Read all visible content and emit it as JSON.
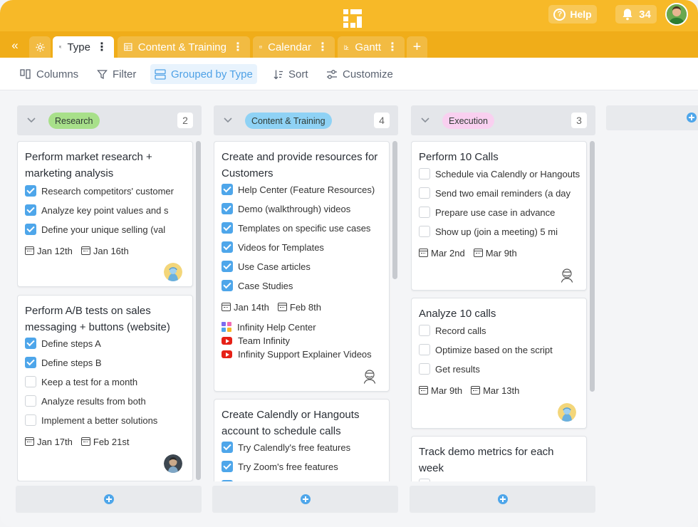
{
  "header": {
    "help_label": "Help",
    "notifications_count": "34"
  },
  "tabs": [
    {
      "label": "Type",
      "menu": "⋮"
    },
    {
      "label": "Content & Training",
      "menu": "⋮"
    },
    {
      "label": "Calendar",
      "menu": "⋮"
    },
    {
      "label": "Gantt",
      "menu": "⋮"
    }
  ],
  "toolbar": {
    "columns_label": "Columns",
    "filter_label": "Filter",
    "grouped_label": "Grouped by Type",
    "sort_label": "Sort",
    "customize_label": "Customize"
  },
  "colors": {
    "topbar": "#f7b928",
    "accent": "#4ea6ea",
    "research": "#a8e08a",
    "content": "#8fd2f5",
    "execution": "#f9d0f0"
  },
  "columns": [
    {
      "label": "Research",
      "count": "2",
      "cards": [
        {
          "title": "Perform market research + marketing analysis",
          "checklist": [
            {
              "text": "Research competitors' customer",
              "checked": true
            },
            {
              "text": "Analyze key point values and s",
              "checked": true
            },
            {
              "text": "Define your unique selling (val",
              "checked": true
            }
          ],
          "dates": [
            "Jan 12th",
            "Jan 16th"
          ]
        },
        {
          "title": "Perform A/B tests on sales messaging + buttons (website)",
          "checklist": [
            {
              "text": "Define steps A",
              "checked": true
            },
            {
              "text": "Define steps B",
              "checked": true
            },
            {
              "text": "Keep a test for a month",
              "checked": false
            },
            {
              "text": "Analyze results from both",
              "checked": false
            },
            {
              "text": "Implement a better solutions",
              "checked": false
            }
          ],
          "dates": [
            "Jan 17th",
            "Feb 21st"
          ]
        }
      ]
    },
    {
      "label": "Content & Training",
      "count": "4",
      "cards": [
        {
          "title": "Create and provide resources for Customers",
          "checklist": [
            {
              "text": "Help Center (Feature Resources)",
              "checked": true
            },
            {
              "text": "Demo (walkthrough) videos",
              "checked": true
            },
            {
              "text": "Templates on specific use cases",
              "checked": true
            },
            {
              "text": "Videos for Templates",
              "checked": true
            },
            {
              "text": "Use Case articles",
              "checked": true
            },
            {
              "text": "Case Studies",
              "checked": true
            }
          ],
          "dates": [
            "Jan 14th",
            "Feb 8th"
          ],
          "links": [
            {
              "text": "Infinity Help Center",
              "icon": "infinity-logo-icon"
            },
            {
              "text": "Team Infinity",
              "icon": "youtube-icon"
            },
            {
              "text": "Infinity Support Explainer Videos",
              "icon": "youtube-icon"
            }
          ]
        },
        {
          "title": "Create Calendly or Hangouts account to schedule calls",
          "checklist": [
            {
              "text": "Try Calendly's free features",
              "checked": true
            },
            {
              "text": "Try Zoom's free features",
              "checked": true
            }
          ]
        }
      ]
    },
    {
      "label": "Execution",
      "count": "3",
      "cards": [
        {
          "title": "Perform 10 Calls",
          "checklist": [
            {
              "text": "Schedule via Calendly or Hangouts",
              "checked": false
            },
            {
              "text": "Send two email reminders (a day",
              "checked": false
            },
            {
              "text": "Prepare use case in advance",
              "checked": false
            },
            {
              "text": "Show up (join a meeting) 5 mi",
              "checked": false
            }
          ],
          "dates": [
            "Mar 2nd",
            "Mar 9th"
          ]
        },
        {
          "title": "Analyze 10 calls",
          "checklist": [
            {
              "text": "Record calls",
              "checked": false
            },
            {
              "text": "Optimize based on the script",
              "checked": false
            },
            {
              "text": "Get results",
              "checked": false
            }
          ],
          "dates": [
            "Mar 9th",
            "Mar 13th"
          ]
        },
        {
          "title": "Track demo metrics for each week",
          "checklist": []
        }
      ]
    }
  ]
}
